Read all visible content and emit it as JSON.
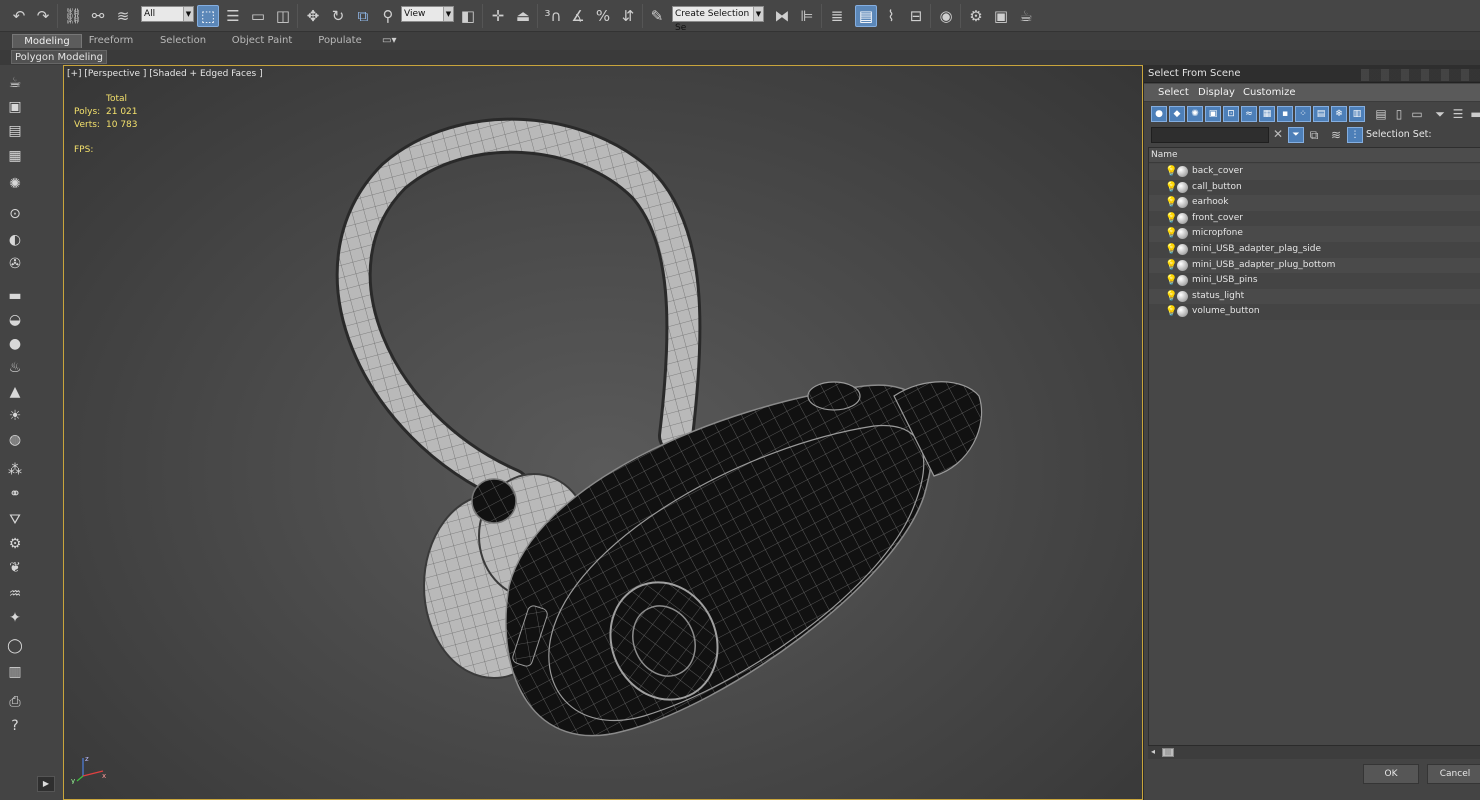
{
  "toolbar": {
    "filter_value": "All",
    "ref_coord_value": "View",
    "selection_set_placeholder": "Create Selection Se",
    "icons": [
      "undo-icon",
      "redo-icon",
      "link-icon",
      "unlink-icon",
      "bind-space-warp-icon",
      "select-object-icon",
      "select-by-name-icon",
      "rect-region-icon",
      "window-crossing-icon",
      "move-icon",
      "rotate-icon",
      "scale-icon",
      "placement-icon",
      "mirror-icon",
      "align-icon",
      "snap-3d-icon",
      "angle-snap-icon",
      "percent-snap-icon",
      "spinner-snap-icon",
      "edit-named-sets-icon",
      "layer-explorer-icon",
      "toggle-ribbon-icon",
      "curve-editor-icon",
      "schematic-view-icon",
      "material-editor-icon",
      "render-setup-icon",
      "rendered-frame-icon",
      "render-icon"
    ]
  },
  "ribbon": {
    "tabs": [
      "Modeling",
      "Freeform",
      "Selection",
      "Object Paint",
      "Populate"
    ],
    "active_tab": "Modeling",
    "sub_panel": "Polygon Modeling"
  },
  "viewport": {
    "label": "[+] [Perspective ] [Shaded + Edged Faces ]",
    "stats_header": "Total",
    "polys_label": "Polys:",
    "polys_value": "21 021",
    "verts_label": "Verts:",
    "verts_value": "10 783",
    "fps_label": "FPS:",
    "gizmo_z": "z",
    "gizmo_x": "x",
    "gizmo_y": "y"
  },
  "dialog": {
    "title": "Select From Scene",
    "menu": [
      "Select",
      "Display",
      "Customize"
    ],
    "selection_set_label": "Selection Set:",
    "column_name": "Name",
    "objects": [
      "back_cover",
      "call_button",
      "earhook",
      "front_cover",
      "micropfone",
      "mini_USB_adapter_plag_side",
      "mini_USB_adapter_plug_bottom",
      "mini_USB_pins",
      "status_light",
      "volume_button"
    ],
    "ok_label": "OK",
    "cancel_label": "Cancel"
  },
  "colors": {
    "viewport_border": "#c9a53c",
    "stats_text": "#f3e06c",
    "active_blue": "#5b87b8",
    "bulb": "#f6d22e"
  }
}
